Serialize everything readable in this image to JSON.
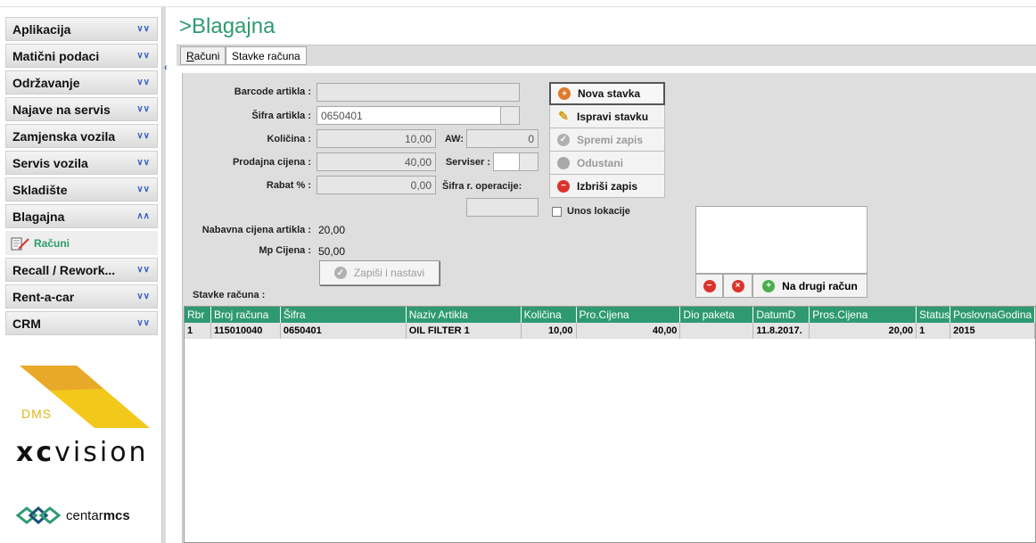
{
  "sidebar": {
    "menu": [
      {
        "label": "Aplikacija",
        "chevron": "double-chevron-down-icon"
      },
      {
        "label": "Matični podaci",
        "chevron": "double-chevron-down-icon"
      },
      {
        "label": "Održavanje",
        "chevron": "double-chevron-down-icon"
      },
      {
        "label": "Najave na servis",
        "chevron": "double-chevron-down-icon"
      },
      {
        "label": "Zamjenska vozila",
        "chevron": "double-chevron-down-icon"
      },
      {
        "label": "Servis vozila",
        "chevron": "double-chevron-down-icon"
      },
      {
        "label": "Skladište",
        "chevron": "double-chevron-down-icon"
      },
      {
        "label": "Blagajna",
        "chevron": "double-chevron-up-icon"
      }
    ],
    "submenu": {
      "label": "Računi"
    },
    "menu_after": [
      {
        "label": "Recall / Rework...",
        "chevron": "double-chevron-down-icon"
      },
      {
        "label": "Rent-a-car",
        "chevron": "double-chevron-down-icon"
      },
      {
        "label": "CRM",
        "chevron": "double-chevron-down-icon"
      }
    ],
    "logo": {
      "dms": "DMS",
      "xc": "xc",
      "vision": "vision",
      "centar": "centar",
      "mcs": "mcs"
    }
  },
  "page": {
    "title": ">Blagajna",
    "tabs": [
      {
        "label": "Računi",
        "underline": "R",
        "rest": "ačuni"
      },
      {
        "label": "Stavke računa"
      }
    ]
  },
  "form": {
    "barcode_label": "Barcode artikla :",
    "barcode_value": "",
    "sifra_label": "Šifra artikla :",
    "sifra_value": "0650401",
    "kolicina_label": "Količina :",
    "kolicina_value": "10,00",
    "aw_label": "AW:",
    "aw_value": "0",
    "prodajna_label": "Prodajna cijena :",
    "prodajna_value": "40,00",
    "serviser_label": "Serviser :",
    "rabat_label": "Rabat % :",
    "rabat_value": "0,00",
    "sifra_op_label": "Šifra r. operacije:",
    "nabavna_label": "Nabavna cijena artikla :",
    "nabavna_value": "20,00",
    "mp_label": "Mp Cijena :",
    "mp_value": "50,00",
    "zapisi_label": "Zapiši i nastavi",
    "stavke_label": "Stavke računa :"
  },
  "actions": [
    {
      "label": "Nova stavka",
      "icon": "plus-circle-icon",
      "color": "#e0792a"
    },
    {
      "label": "Ispravi stavku",
      "icon": "pencil-icon",
      "color": "#d4a017"
    },
    {
      "label": "Spremi zapis",
      "icon": "check-circle-icon",
      "color": "#a8a8a8"
    },
    {
      "label": "Odustani",
      "icon": "stop-circle-icon",
      "color": "#a8a8a8"
    },
    {
      "label": "Izbriši zapis",
      "icon": "minus-circle-icon",
      "color": "#d9342b"
    }
  ],
  "unos_lokacije": "Unos lokacije",
  "na_drugi_racun": "Na drugi račun",
  "grid": {
    "columns": [
      "Rbr",
      "Broj računa",
      "Šifra",
      "Naziv Artikla",
      "Količina",
      "Pro.Cijena",
      "Dio paketa",
      "DatumD",
      "Pros.Cijena",
      "Status",
      "PoslovnaGodina"
    ],
    "rows": [
      [
        "1",
        "115010040",
        "0650401",
        "OIL FILTER 1",
        "10,00",
        "40,00",
        "",
        "11.8.2017.",
        "20,00",
        "1",
        "2015"
      ]
    ]
  },
  "colors": {
    "accent": "#2f9a72",
    "title": "#2f9a72"
  }
}
